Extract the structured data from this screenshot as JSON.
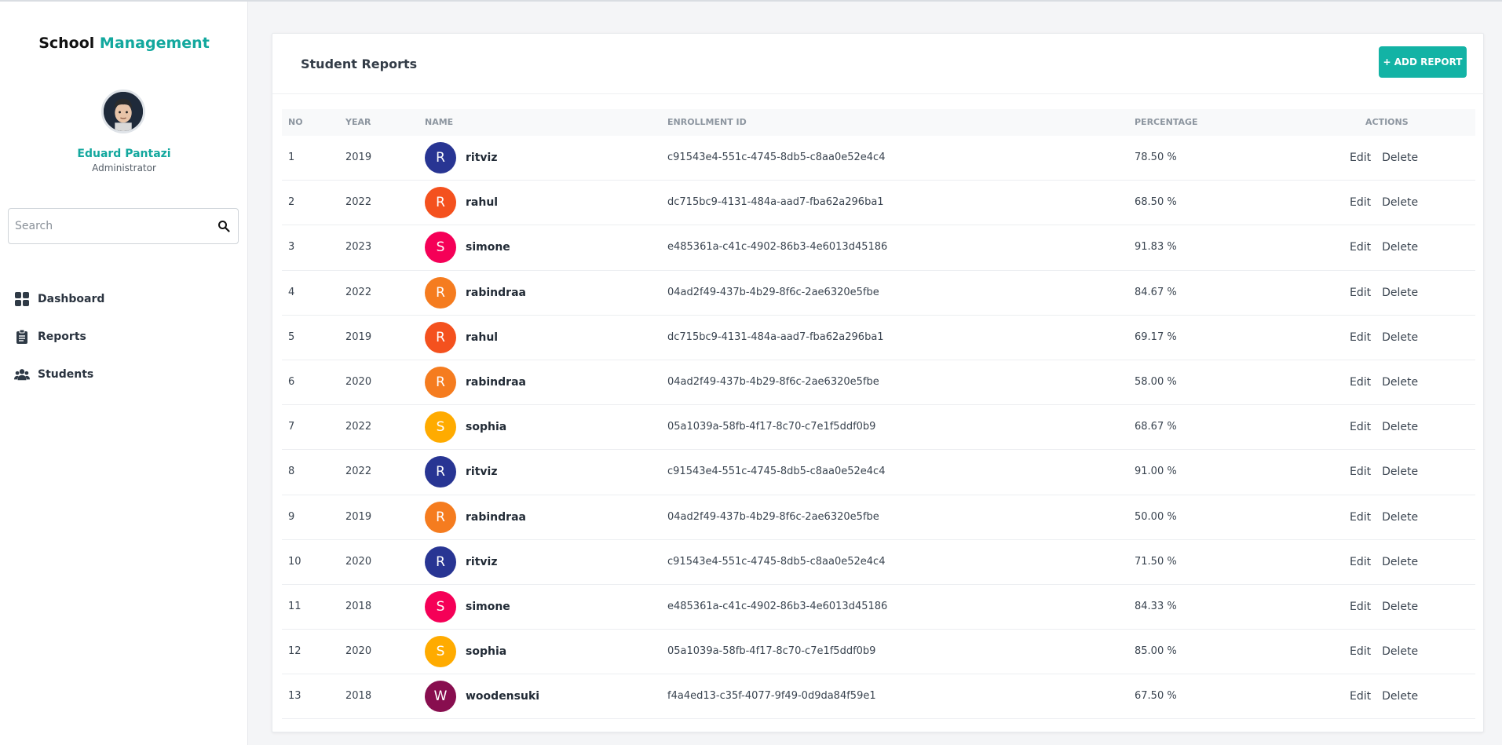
{
  "brand": {
    "part1": "School",
    "part2": "Management"
  },
  "user": {
    "name": "Eduard Pantazi",
    "role": "Administrator"
  },
  "search": {
    "placeholder": "Search"
  },
  "nav": {
    "items": [
      {
        "label": "Dashboard",
        "icon": "grid-icon"
      },
      {
        "label": "Reports",
        "icon": "clipboard-icon"
      },
      {
        "label": "Students",
        "icon": "users-icon"
      }
    ]
  },
  "main": {
    "title": "Student Reports",
    "add_button": "+ ADD REPORT",
    "columns": [
      "NO",
      "YEAR",
      "NAME",
      "ENROLLMENT ID",
      "PERCENTAGE",
      "ACTIONS"
    ],
    "edit_label": "Edit",
    "delete_label": "Delete",
    "rows": [
      {
        "no": "1",
        "year": "2019",
        "initial": "R",
        "color": "#283593",
        "name": "ritviz",
        "enrollment": "c91543e4-551c-4745-8db5-c8aa0e52e4c4",
        "percentage": "78.50 %"
      },
      {
        "no": "2",
        "year": "2022",
        "initial": "R",
        "color": "#f4511e",
        "name": "rahul",
        "enrollment": "dc715bc9-4131-484a-aad7-fba62a296ba1",
        "percentage": "68.50 %"
      },
      {
        "no": "3",
        "year": "2023",
        "initial": "S",
        "color": "#f50057",
        "name": "simone",
        "enrollment": "e485361a-c41c-4902-86b3-4e6013d45186",
        "percentage": "91.83 %"
      },
      {
        "no": "4",
        "year": "2022",
        "initial": "R",
        "color": "#f57c1f",
        "name": "rabindraa",
        "enrollment": "04ad2f49-437b-4b29-8f6c-2ae6320e5fbe",
        "percentage": "84.67 %"
      },
      {
        "no": "5",
        "year": "2019",
        "initial": "R",
        "color": "#f4511e",
        "name": "rahul",
        "enrollment": "dc715bc9-4131-484a-aad7-fba62a296ba1",
        "percentage": "69.17 %"
      },
      {
        "no": "6",
        "year": "2020",
        "initial": "R",
        "color": "#f57c1f",
        "name": "rabindraa",
        "enrollment": "04ad2f49-437b-4b29-8f6c-2ae6320e5fbe",
        "percentage": "58.00 %"
      },
      {
        "no": "7",
        "year": "2022",
        "initial": "S",
        "color": "#ffab00",
        "name": "sophia",
        "enrollment": "05a1039a-58fb-4f17-8c70-c7e1f5ddf0b9",
        "percentage": "68.67 %"
      },
      {
        "no": "8",
        "year": "2022",
        "initial": "R",
        "color": "#283593",
        "name": "ritviz",
        "enrollment": "c91543e4-551c-4745-8db5-c8aa0e52e4c4",
        "percentage": "91.00 %"
      },
      {
        "no": "9",
        "year": "2019",
        "initial": "R",
        "color": "#f57c1f",
        "name": "rabindraa",
        "enrollment": "04ad2f49-437b-4b29-8f6c-2ae6320e5fbe",
        "percentage": "50.00 %"
      },
      {
        "no": "10",
        "year": "2020",
        "initial": "R",
        "color": "#283593",
        "name": "ritviz",
        "enrollment": "c91543e4-551c-4745-8db5-c8aa0e52e4c4",
        "percentage": "71.50 %"
      },
      {
        "no": "11",
        "year": "2018",
        "initial": "S",
        "color": "#f50057",
        "name": "simone",
        "enrollment": "e485361a-c41c-4902-86b3-4e6013d45186",
        "percentage": "84.33 %"
      },
      {
        "no": "12",
        "year": "2020",
        "initial": "S",
        "color": "#ffab00",
        "name": "sophia",
        "enrollment": "05a1039a-58fb-4f17-8c70-c7e1f5ddf0b9",
        "percentage": "85.00 %"
      },
      {
        "no": "13",
        "year": "2018",
        "initial": "W",
        "color": "#880e4f",
        "name": "woodensuki",
        "enrollment": "f4a4ed13-c35f-4077-9f49-0d9da84f59e1",
        "percentage": "67.50 %"
      }
    ]
  }
}
